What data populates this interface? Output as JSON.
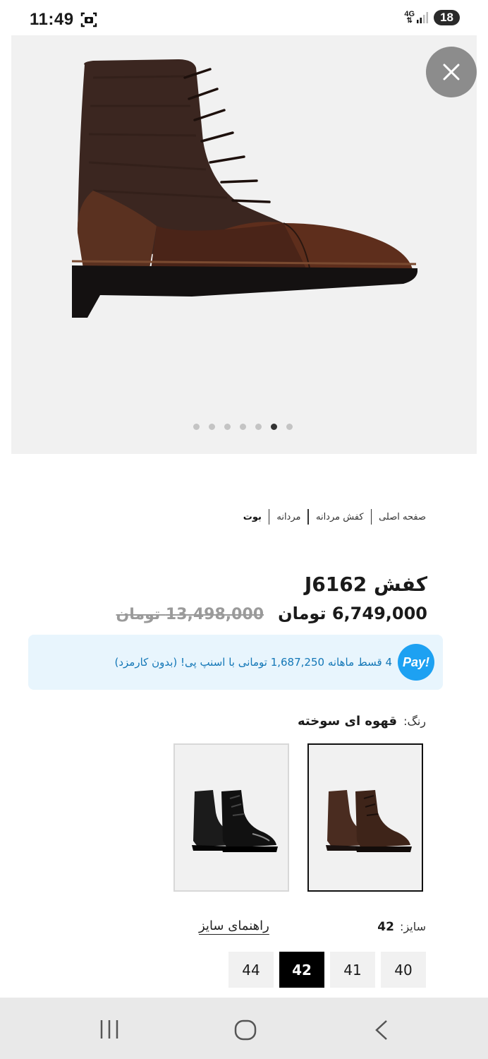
{
  "status_bar": {
    "time": "11:49",
    "network": "4G",
    "battery": "18"
  },
  "gallery": {
    "dot_count": 7,
    "active_dot": 6
  },
  "breadcrumb": {
    "items": [
      "صفحه اصلی",
      "کفش مردانه",
      "مردانه",
      "بوت"
    ]
  },
  "product": {
    "title": "کفش J6162",
    "price": "6,749,000 تومان",
    "old_price": "13,498,000 تومان"
  },
  "snappay": {
    "logo_text": "Pay!",
    "text": "4 قسط ماهانه 1,687,250 تومانی با اسنپ پی! (بدون کارمزد)"
  },
  "color": {
    "label": "رنگ:",
    "value": "قهوه ای سوخته",
    "options": [
      {
        "name": "brown",
        "color": "#4a2c20",
        "selected": true
      },
      {
        "name": "black",
        "color": "#141414",
        "selected": false
      }
    ]
  },
  "size": {
    "label": "سایز:",
    "value": "42",
    "guide_label": "راهنمای سایز",
    "options": [
      "40",
      "41",
      "42",
      "44"
    ],
    "selected": "42"
  },
  "colors": {
    "snappay_bg": "#e8f5fd",
    "snappay_blue": "#1da1f2",
    "selected_size_bg": "#000000"
  }
}
